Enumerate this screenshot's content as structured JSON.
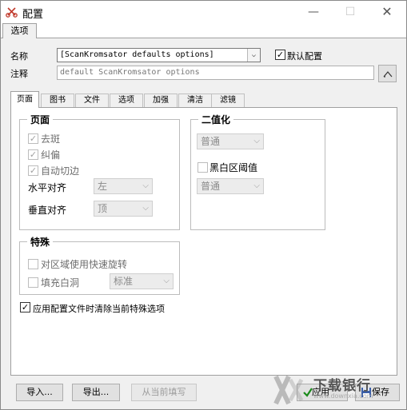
{
  "window": {
    "title": "配置",
    "minimize": "—",
    "maximize": "☐",
    "close": "✕"
  },
  "top_tab": "选项",
  "name_row": {
    "label": "名称",
    "value": "[ScanKromsator defaults options]",
    "default_checked": true,
    "default_label": "默认配置"
  },
  "note_row": {
    "label": "注释",
    "placeholder": "default ScanKromsator options"
  },
  "tabs": [
    "页面",
    "图书",
    "文件",
    "选项",
    "加强",
    "清洁",
    "滤镜"
  ],
  "page_group": {
    "title": "页面",
    "despeckle": "去斑",
    "deskew": "纠偏",
    "autocut": "自动切边",
    "halign_label": "水平对齐",
    "halign_value": "左",
    "valign_label": "垂直对齐",
    "valign_value": "顶"
  },
  "binarize_group": {
    "title": "二值化",
    "mode": "普通",
    "bw_threshold_label": "黑白区阈值",
    "bw_threshold_mode": "普通"
  },
  "special_group": {
    "title": "特殊",
    "fast_rotate": "对区域使用快速旋转",
    "fill_holes": "填充白洞",
    "fill_value": "标准"
  },
  "clear_special_label": "应用配置文件时清除当前特殊选项",
  "buttons": {
    "import": "导入...",
    "export": "导出...",
    "from_current": "从当前填写",
    "apply": "应用",
    "save": "保存"
  },
  "watermark": {
    "text": "下载银行",
    "url": "www.downxia.com"
  }
}
